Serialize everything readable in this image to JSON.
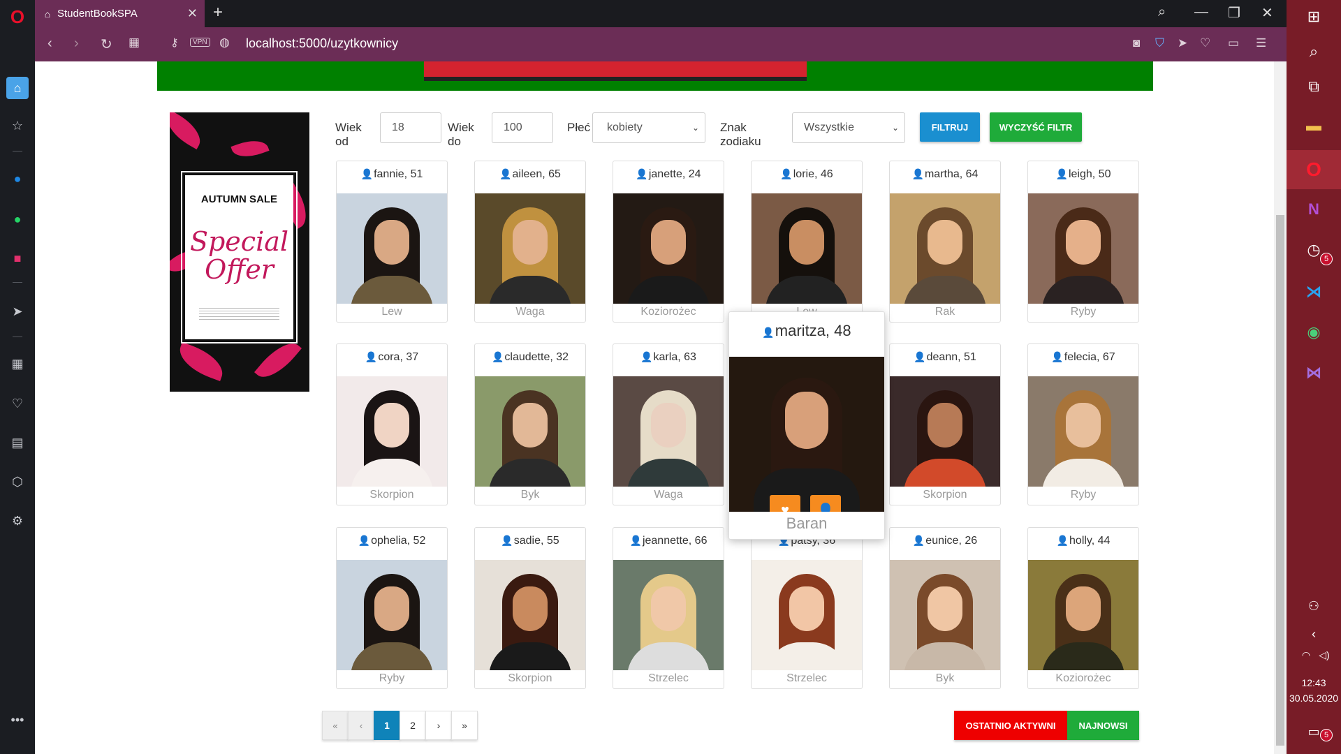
{
  "browser": {
    "tab_title": "StudentBookSPA",
    "url": "localhost:5000/uzytkownicy",
    "vpn_label": "VPN"
  },
  "taskbar": {
    "time": "12:43",
    "date": "30.05.2020",
    "badge_count": "5",
    "notif_count": "5"
  },
  "ad": {
    "title": "AUTUMN SALE",
    "script_line1": "Special",
    "script_line2": "Offer"
  },
  "filter": {
    "age_from_label": "Wiek od",
    "age_from_value": "18",
    "age_to_label": "Wiek do",
    "age_to_value": "100",
    "gender_label": "Płeć",
    "gender_value": "kobiety",
    "zodiac_label": "Znak zodiaku",
    "zodiac_value": "Wszystkie",
    "filter_button": "FILTRUJ",
    "clear_button": "WYCZYŚĆ FILTR"
  },
  "members": [
    {
      "name": "fannie, 51",
      "zodiac": "Lew",
      "skin": "#d9a884",
      "hair": "#1b1512",
      "bg": "#c9d4df",
      "top": "#6b5a3c"
    },
    {
      "name": "aileen, 65",
      "zodiac": "Waga",
      "skin": "#e2b18c",
      "hair": "#c0913f",
      "bg": "#5a4a2a",
      "top": "#2a2a2a"
    },
    {
      "name": "janette, 24",
      "zodiac": "Koziorożec",
      "skin": "#d7a07a",
      "hair": "#2a1a12",
      "bg": "#231a14",
      "top": "#1a1a1a"
    },
    {
      "name": "lorie, 46",
      "zodiac": "Lew",
      "skin": "#c98e62",
      "hair": "#15100c",
      "bg": "#7b5a45",
      "top": "#222"
    },
    {
      "name": "martha, 64",
      "zodiac": "Rak",
      "skin": "#e8b98e",
      "hair": "#6b4a2c",
      "bg": "#c4a26c",
      "top": "#5a4a3a"
    },
    {
      "name": "leigh, 50",
      "zodiac": "Ryby",
      "skin": "#e5b08a",
      "hair": "#4a2a18",
      "bg": "#8a6a5a",
      "top": "#2a2222"
    },
    {
      "name": "cora, 37",
      "zodiac": "Skorpion",
      "skin": "#f0d4c4",
      "hair": "#1a1414",
      "bg": "#f2eaea",
      "top": "#f6f0ee"
    },
    {
      "name": "claudette, 32",
      "zodiac": "Byk",
      "skin": "#e2b897",
      "hair": "#4a3322",
      "bg": "#8a9a6a",
      "top": "#2a2a2a"
    },
    {
      "name": "karla, 63",
      "zodiac": "Waga",
      "skin": "#ead0c0",
      "hair": "#e6dcc8",
      "bg": "#5a4a44",
      "top": "#2f3a3a"
    },
    {
      "name": "deann, 51",
      "zodiac": "Skorpion",
      "skin": "#b77a56",
      "hair": "#2a1510",
      "bg": "#3a2a2a",
      "top": "#d24a2a"
    },
    {
      "name": "felecia, 67",
      "zodiac": "Ryby",
      "skin": "#e8bf9c",
      "hair": "#a8743a",
      "bg": "#8a7a6a",
      "top": "#f2ece4"
    },
    {
      "name": "ophelia, 52",
      "zodiac": "Ryby",
      "skin": "#d9a884",
      "hair": "#1b1512",
      "bg": "#c9d4df",
      "top": "#6b5a3c"
    },
    {
      "name": "sadie, 55",
      "zodiac": "Skorpion",
      "skin": "#c98a5e",
      "hair": "#3a1a10",
      "bg": "#e6e0d8",
      "top": "#1a1a1a"
    },
    {
      "name": "jeannette, 66",
      "zodiac": "Strzelec",
      "skin": "#f0c8a8",
      "hair": "#e4c98a",
      "bg": "#6a7a6a",
      "top": "#ddd"
    },
    {
      "name": "patsy, 36",
      "zodiac": "Strzelec",
      "skin": "#f2c6a6",
      "hair": "#8a3a1e",
      "bg": "#f4efe8",
      "top": "#f4efe8"
    },
    {
      "name": "eunice, 26",
      "zodiac": "Byk",
      "skin": "#f0c6a4",
      "hair": "#7a4a2a",
      "bg": "#cfc1b2",
      "top": "#c8b8a8"
    },
    {
      "name": "holly, 44",
      "zodiac": "Koziorożec",
      "skin": "#dca57a",
      "hair": "#4a3018",
      "bg": "#8a7a3a",
      "top": "#2a2a1a"
    }
  ],
  "hover_card": {
    "name": "maritza, 48",
    "zodiac": "Baran",
    "skin": "#d8a07a",
    "hair": "#2a1810",
    "bg": "#24180f",
    "top": "#1a1a1a"
  },
  "pagination": {
    "first": "«",
    "prev": "‹",
    "pages": [
      "1",
      "2"
    ],
    "active_page": "1",
    "next": "›",
    "last": "»"
  },
  "sort": {
    "recent": "OSTATNIO AKTYWNI",
    "newest": "NAJNOWSI"
  },
  "colors": {
    "browser_accent": "#6b2d56",
    "taskbar": "#781c27",
    "filter_blue": "#1a8fd0",
    "filter_green": "#1fab3a",
    "sort_red": "#ee0000",
    "sort_green": "#1fab3a",
    "hover_buttons": "#f68b1f"
  }
}
